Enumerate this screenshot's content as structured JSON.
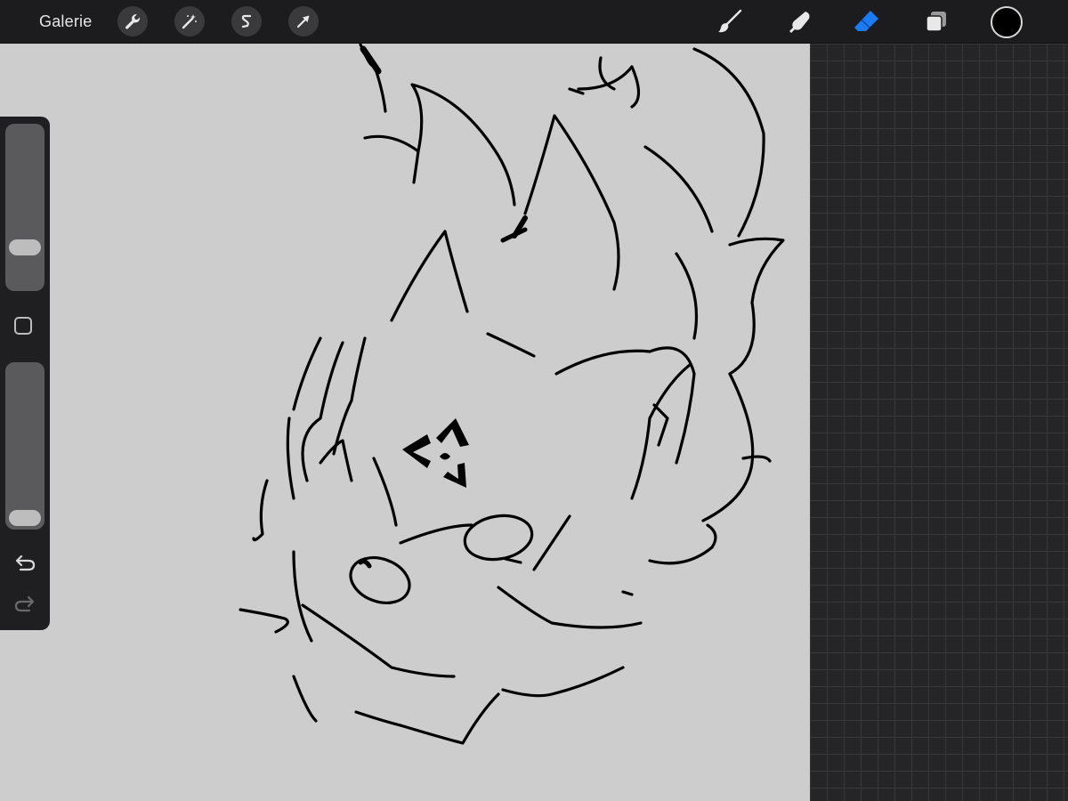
{
  "topbar": {
    "gallery_label": "Galerie",
    "left_tools": [
      {
        "icon": "wrench-icon"
      },
      {
        "icon": "magic-wand-icon"
      },
      {
        "icon": "selection-s-icon"
      },
      {
        "icon": "transform-arrow-icon"
      }
    ],
    "right_tools": [
      {
        "icon": "brush-icon"
      },
      {
        "icon": "smudge-icon"
      },
      {
        "icon": "eraser-icon",
        "active": true
      },
      {
        "icon": "layers-icon"
      }
    ],
    "current_color": "#000000",
    "active_tool_color": "#1a7cf5"
  },
  "sidebar": {
    "brush_size_level": 0.22,
    "opacity_level": 0.0
  },
  "canvas": {
    "background": "#cdcdcd",
    "stroke_color": "#000000"
  }
}
